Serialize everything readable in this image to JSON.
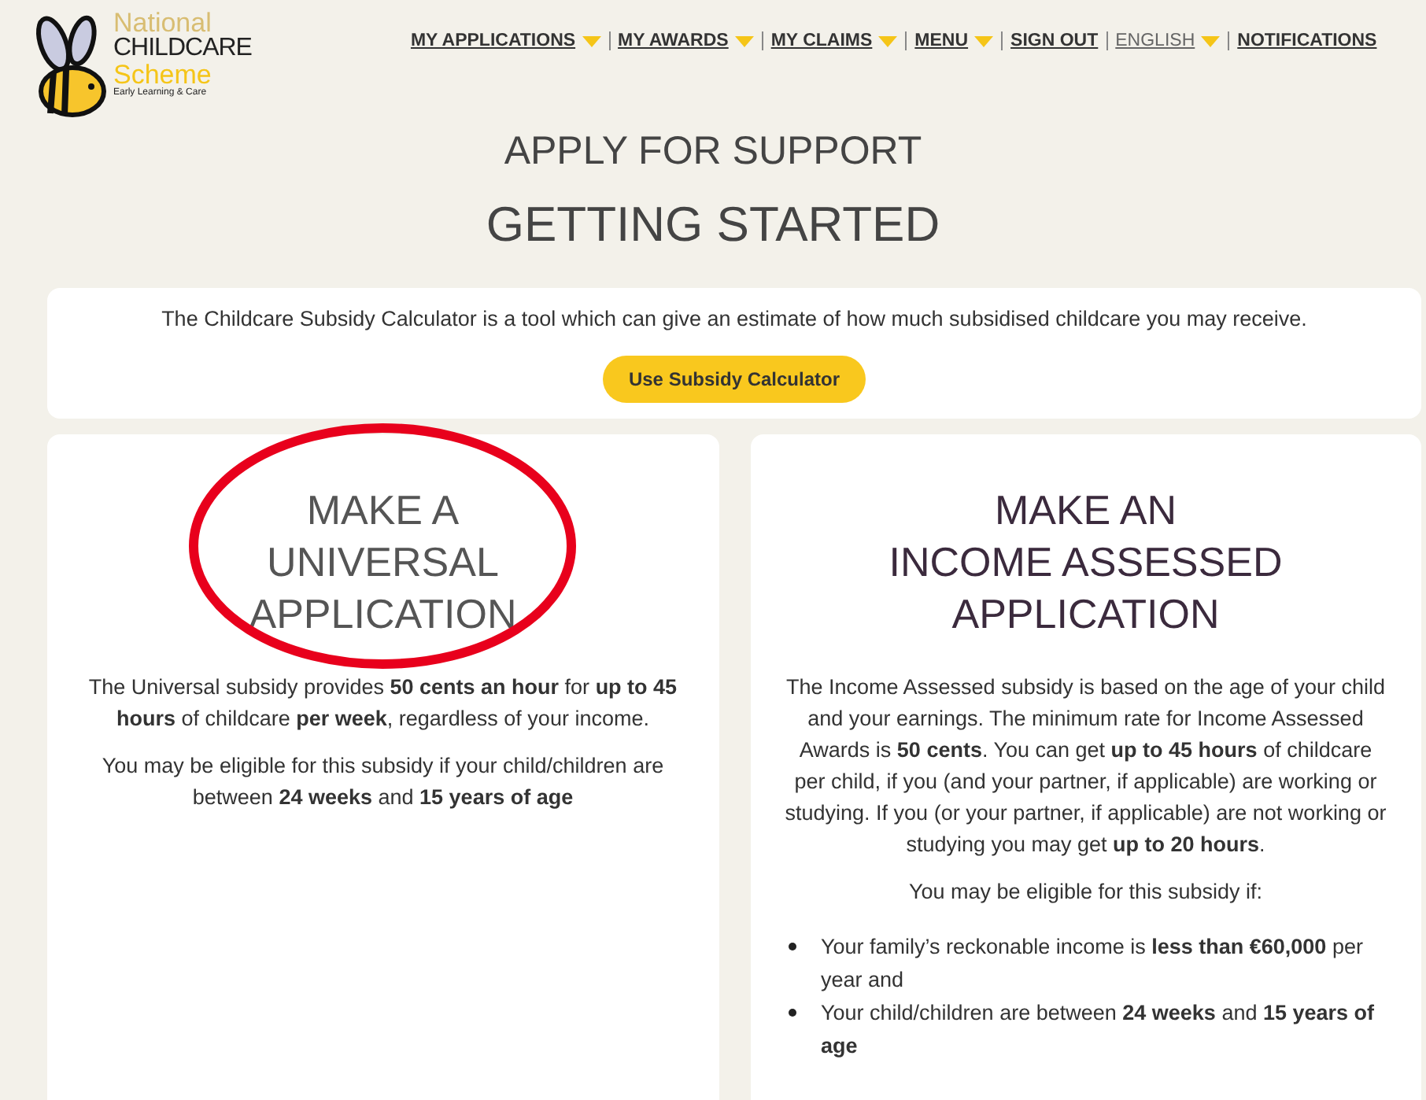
{
  "logo": {
    "line_1": "National",
    "line_2": "CHILDCARE",
    "line_3": "Scheme",
    "tagline": "Early Learning & Care"
  },
  "nav": [
    {
      "label": "MY APPLICATIONS",
      "has_menu": true,
      "muted": false
    },
    {
      "label": "MY AWARDS",
      "has_menu": true,
      "muted": false
    },
    {
      "label": "MY CLAIMS",
      "has_menu": true,
      "muted": false
    },
    {
      "label": "MENU",
      "has_menu": true,
      "muted": false
    },
    {
      "label": "SIGN OUT",
      "has_menu": false,
      "muted": false
    },
    {
      "label": "ENGLISH",
      "has_menu": true,
      "muted": true
    },
    {
      "label": "NOTIFICATIONS",
      "has_menu": false,
      "muted": false
    }
  ],
  "page_title": "APPLY FOR SUPPORT",
  "page_subtitle": "GETTING STARTED",
  "calculator": {
    "text": "The Childcare Subsidy Calculator is a tool which can give an estimate of how much subsidised childcare you may receive.",
    "button": "Use Subsidy Calculator"
  },
  "cards": [
    {
      "title_lines": [
        "MAKE A",
        "UNIVERSAL",
        "APPLICATION"
      ],
      "circled": true,
      "paragraphs": [
        "The Universal subsidy provides **50 cents an hour** for **up to 45 hours** of childcare **per week**, regardless of your income.",
        "You may be eligible for this subsidy if your child/children are between **24 weeks** and **15 years of age**"
      ]
    },
    {
      "title_lines": [
        "MAKE AN",
        "INCOME ASSESSED",
        "APPLICATION"
      ],
      "circled": false,
      "paragraphs": [
        "The Income Assessed subsidy is based on the age of your child and your earnings. The minimum rate for Income Assessed Awards is **50 cents**. You can get **up to 45 hours** of childcare per child, if you (and your partner, if applicable) are working or studying. If you (or your partner, if applicable) are not working or studying you may get **up to 20 hours**.",
        "You may be eligible for this subsidy if:"
      ],
      "bullets": [
        "Your family’s reckonable income is **less than €60,000** per year and",
        "Your child/children are between **24 weeks** and **15 years of age**"
      ]
    }
  ]
}
